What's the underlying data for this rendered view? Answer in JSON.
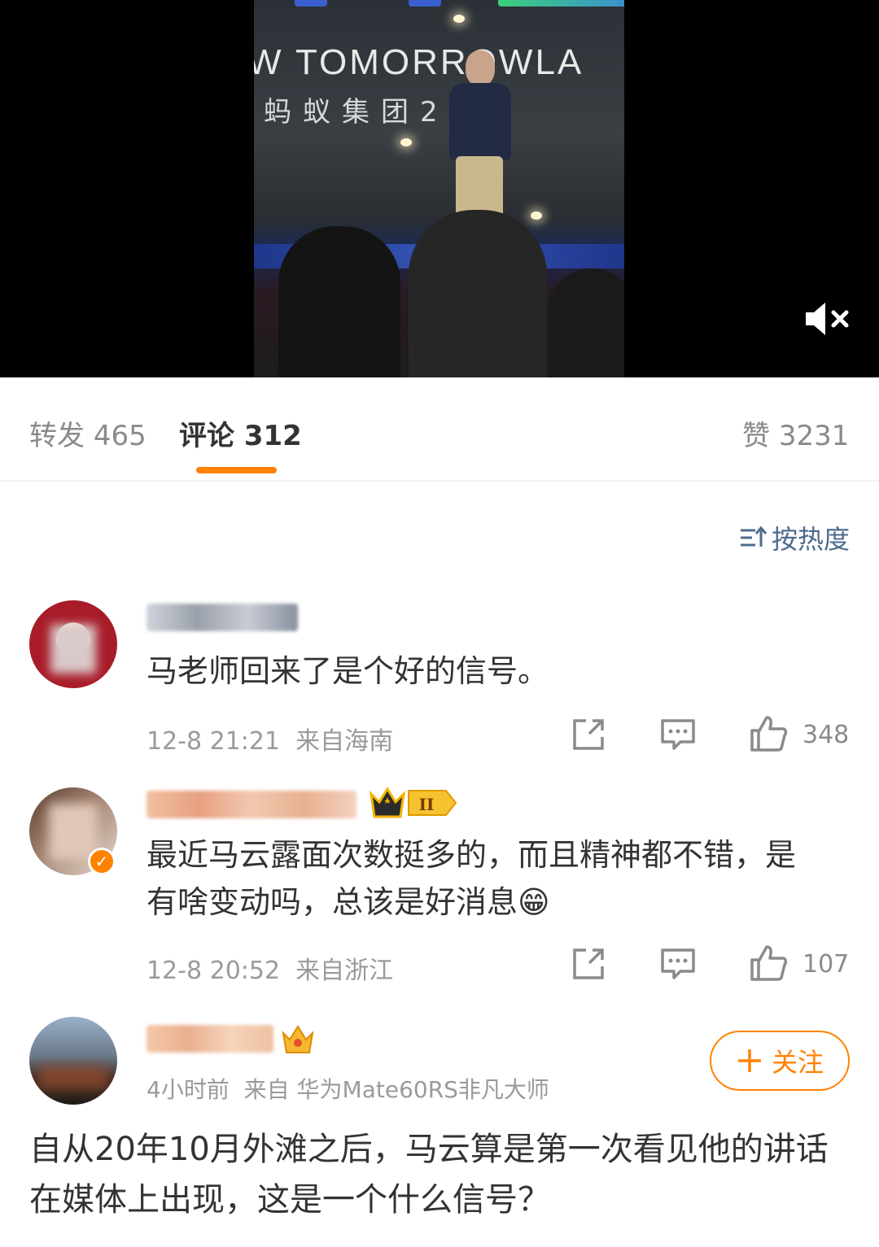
{
  "video": {
    "stage_text_en": "W TOMORROWLA",
    "stage_text_cn": "蚂蚁集团2 年",
    "mute_icon": "mute-icon"
  },
  "tabs": {
    "repost": {
      "label": "转发",
      "count": "465"
    },
    "comments": {
      "label": "评论",
      "count": "312"
    },
    "likes": {
      "label": "赞",
      "count": "3231"
    },
    "accent_color": "#ff8200"
  },
  "sort": {
    "label": "按热度",
    "icon": "sort-icon"
  },
  "comments": [
    {
      "text": "马老师回来了是个好的信号。",
      "time": "12-8 21:21",
      "location": "来自海南",
      "likes": "348"
    },
    {
      "text": "最近马云露面次数挺多的，而且精神都不错，是有啥变动吗，总该是好消息",
      "emoji": "😁",
      "time": "12-8 20:52",
      "location": "来自浙江",
      "likes": "107"
    }
  ],
  "post": {
    "time": "4小时前",
    "source": "来自 华为Mate60RS非凡大师",
    "follow_label": "关注",
    "text": "自从20年10月外滩之后，马云算是第一次看见他的讲话在媒体上出现，这是一个什么信号？"
  }
}
